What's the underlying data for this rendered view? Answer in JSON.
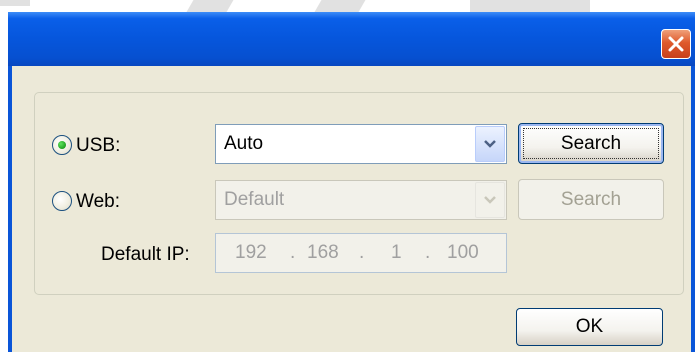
{
  "dialog": {
    "close_label": "Close"
  },
  "usb": {
    "label": "USB:",
    "selected": true,
    "combo_value": "Auto",
    "search_label": "Search"
  },
  "web": {
    "label": "Web:",
    "selected": false,
    "combo_value": "Default",
    "search_label": "Search"
  },
  "ip": {
    "label": "Default IP:",
    "octets": [
      "192",
      "168",
      "1",
      "100"
    ],
    "separator": "."
  },
  "footer": {
    "ok_label": "OK"
  },
  "colors": {
    "titlebar": "#0656dc",
    "client_bg": "#ece9d8",
    "close_red": "#df5a2c",
    "radio_dot": "#21a121"
  }
}
